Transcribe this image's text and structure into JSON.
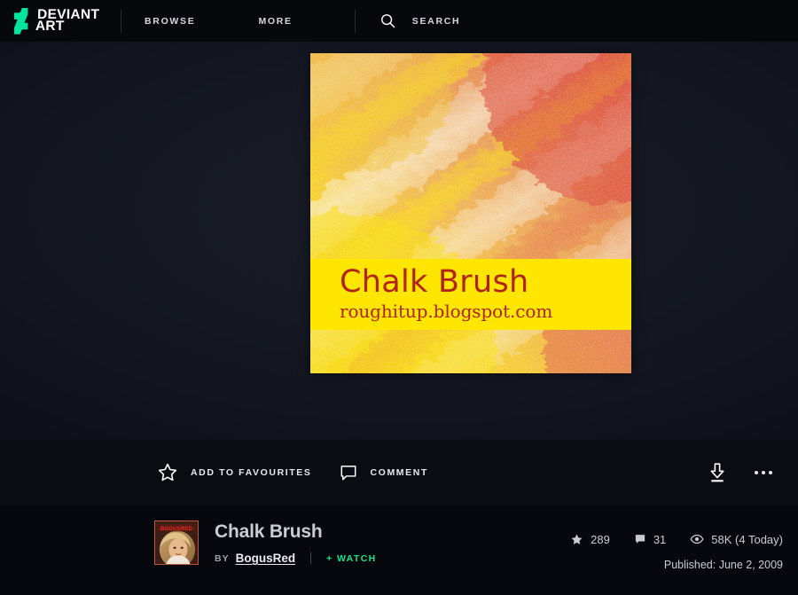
{
  "header": {
    "logo": {
      "line1": "DEVIANT",
      "line2": "ART",
      "icon": "deviantart-logo-icon",
      "color": "#00e59b"
    },
    "nav": [
      {
        "id": "browse",
        "label": "BROWSE"
      },
      {
        "id": "more",
        "label": "MORE"
      }
    ],
    "search": {
      "label": "SEARCH",
      "icon": "search-icon"
    }
  },
  "artwork": {
    "alt": "Chalk Brush preview",
    "banner_title": "Chalk Brush",
    "banner_subtitle": "roughitup.blogspot.com",
    "banner_bg": "#ffe600",
    "banner_text_color": "#b02316"
  },
  "toolbar": {
    "favourite_label": "ADD TO FAVOURITES",
    "favourite_icon": "star-outline-icon",
    "comment_label": "COMMENT",
    "comment_icon": "speech-bubble-icon",
    "download_icon": "download-icon",
    "more_icon": "ellipsis-icon"
  },
  "info": {
    "title": "Chalk Brush",
    "by_label": "BY",
    "author": "BogusRed",
    "watch_label": "+ WATCH",
    "watch_color": "#0fe68f",
    "avatar": {
      "name": "avatar",
      "caption": "BOGUSRED"
    },
    "stats": [
      {
        "id": "favourites",
        "icon": "star-filled-icon",
        "value": "289"
      },
      {
        "id": "comments",
        "icon": "comment-filled-icon",
        "value": "31"
      },
      {
        "id": "views",
        "icon": "eye-icon",
        "value": "58K (4 Today)"
      }
    ],
    "published": "Published: June 2, 2009"
  }
}
